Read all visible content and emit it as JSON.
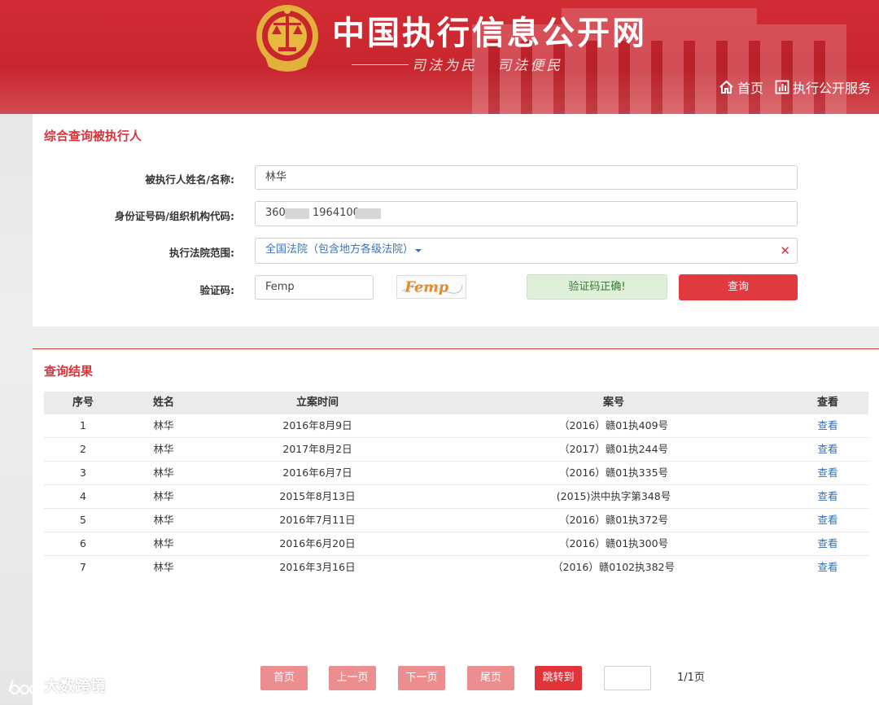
{
  "header": {
    "title": "中国执行信息公开网",
    "slogan": "司法为民   司法便民",
    "nav": [
      {
        "label": "首页",
        "icon": "home-icon"
      },
      {
        "label": "执行公开服务",
        "icon": "chart-icon"
      }
    ]
  },
  "search": {
    "title": "综合查询被执行人",
    "name_label": "被执行人姓名/名称:",
    "name_value": "林华",
    "id_label": "身份证号码/组织机构代码:",
    "id_value_prefix": "360",
    "id_value_mid": "1964100",
    "court_label": "执行法院范围:",
    "court_value": "全国法院（包含地方各级法院）",
    "captcha_label": "验证码:",
    "captcha_value": "Femp",
    "captcha_image_text": "Femp",
    "captcha_status": "验证码正确!",
    "submit_label": "查询"
  },
  "results": {
    "title": "查询结果",
    "columns": [
      "序号",
      "姓名",
      "立案时间",
      "案号",
      "查看"
    ],
    "rows": [
      {
        "no": "1",
        "name": "林华",
        "date": "2016年8月9日",
        "case": "（2016）赣01执409号",
        "view": "查看"
      },
      {
        "no": "2",
        "name": "林华",
        "date": "2017年8月2日",
        "case": "（2017）赣01执244号",
        "view": "查看"
      },
      {
        "no": "3",
        "name": "林华",
        "date": "2016年6月7日",
        "case": "（2016）赣01执335号",
        "view": "查看"
      },
      {
        "no": "4",
        "name": "林华",
        "date": "2015年8月13日",
        "case": "(2015)洪中执字第348号",
        "view": "查看"
      },
      {
        "no": "5",
        "name": "林华",
        "date": "2016年7月11日",
        "case": "（2016）赣01执372号",
        "view": "查看"
      },
      {
        "no": "6",
        "name": "林华",
        "date": "2016年6月20日",
        "case": "（2016）赣01执300号",
        "view": "查看"
      },
      {
        "no": "7",
        "name": "林华",
        "date": "2016年3月16日",
        "case": "（2016）赣0102执382号",
        "view": "查看"
      }
    ]
  },
  "pager": {
    "first": "首页",
    "prev": "上一页",
    "next": "下一页",
    "last": "尾页",
    "go": "跳转到",
    "info": "1/1页"
  },
  "watermark": "大数跨境",
  "colors": {
    "brand_red": "#d22c34",
    "title_red": "#d9333c",
    "link_blue": "#3170b5",
    "success_bg": "#def0d8"
  }
}
